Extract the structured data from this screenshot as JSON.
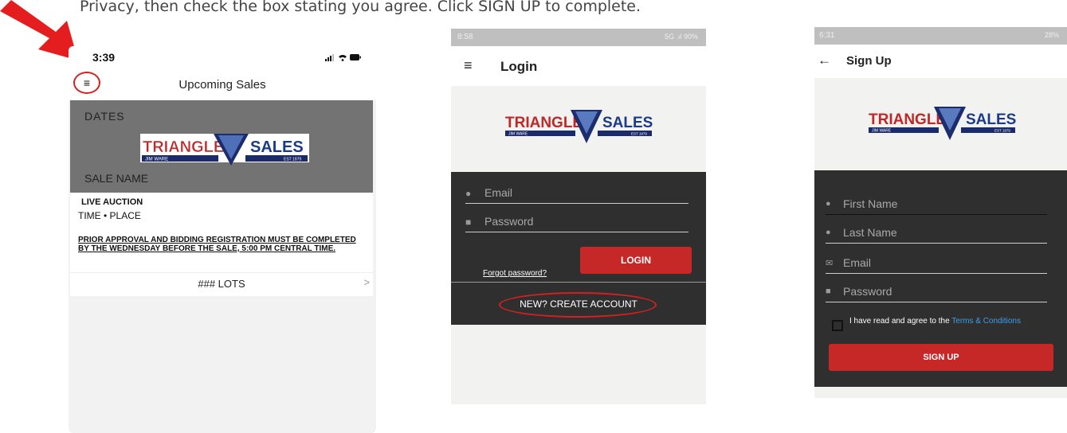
{
  "instruction": {
    "text": "Privacy, then check the box stating you agree. Click SIGN UP to complete."
  },
  "colors": {
    "accent_red": "#c62828",
    "annotation_red": "#d42020",
    "dark_panel": "#2f2f2f",
    "link_blue": "#3aa0e8"
  },
  "logo": {
    "word_left": "TRIANGLE",
    "word_right": "SALES",
    "owner": "JIM WARE",
    "established": "EST 1979"
  },
  "screen_upcoming": {
    "status_time": "3:39",
    "status_icons": "signal-wifi-battery",
    "menu_icon": "≡",
    "title": "Upcoming Sales",
    "card": {
      "dates_label": "DATES",
      "sale_name_label": "SALE NAME",
      "auction_type": "LIVE AUCTION",
      "time_place": "TIME • PLACE",
      "notice": "PRIOR APPROVAL AND BIDDING REGISTRATION MUST BE COMPLETED BY THE WEDNESDAY BEFORE THE SALE, 5:00 PM CENTRAL TIME.",
      "lots_label": "### LOTS",
      "lots_chevron": ">"
    }
  },
  "screen_login": {
    "status_time": "8:58",
    "status_right": "5G .ıl 90%",
    "menu_icon": "≡",
    "title": "Login",
    "email_placeholder": "Email",
    "password_placeholder": "Password",
    "forgot_link": "Forgot password?",
    "login_button": "LOGIN",
    "create_account": "NEW? CREATE ACCOUNT"
  },
  "screen_signup": {
    "status_time": "6:31",
    "status_right": "28%",
    "back_icon": "←",
    "title": "Sign Up",
    "first_name_placeholder": "First Name",
    "last_name_placeholder": "Last Name",
    "email_placeholder": "Email",
    "password_placeholder": "Password",
    "agree_text": "I have read and agree to the",
    "terms_link": "Terms & Conditions",
    "signup_button": "SIGN UP"
  }
}
